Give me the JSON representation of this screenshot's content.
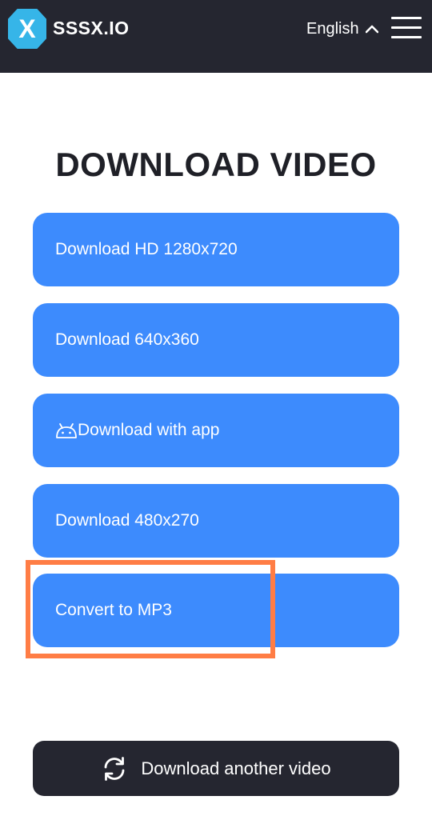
{
  "header": {
    "logo_text": "SSSX.IO",
    "logo_letter": "X",
    "language": "English",
    "colors": {
      "background": "#252630",
      "logo_accent": "#36b5e8"
    }
  },
  "main": {
    "title": "DOWNLOAD VIDEO",
    "buttons": [
      {
        "label": "Download HD 1280x720",
        "icon": null
      },
      {
        "label": "Download 640x360",
        "icon": null
      },
      {
        "label": "Download with app",
        "icon": "android-icon"
      },
      {
        "label": "Download 480x270",
        "icon": null
      },
      {
        "label": "Convert to MP3",
        "icon": null
      }
    ],
    "button_color": "#3d8bfd",
    "highlight_color": "#ff7d45"
  },
  "footer": {
    "another_label": "Download another video",
    "another_icon": "refresh-icon"
  }
}
